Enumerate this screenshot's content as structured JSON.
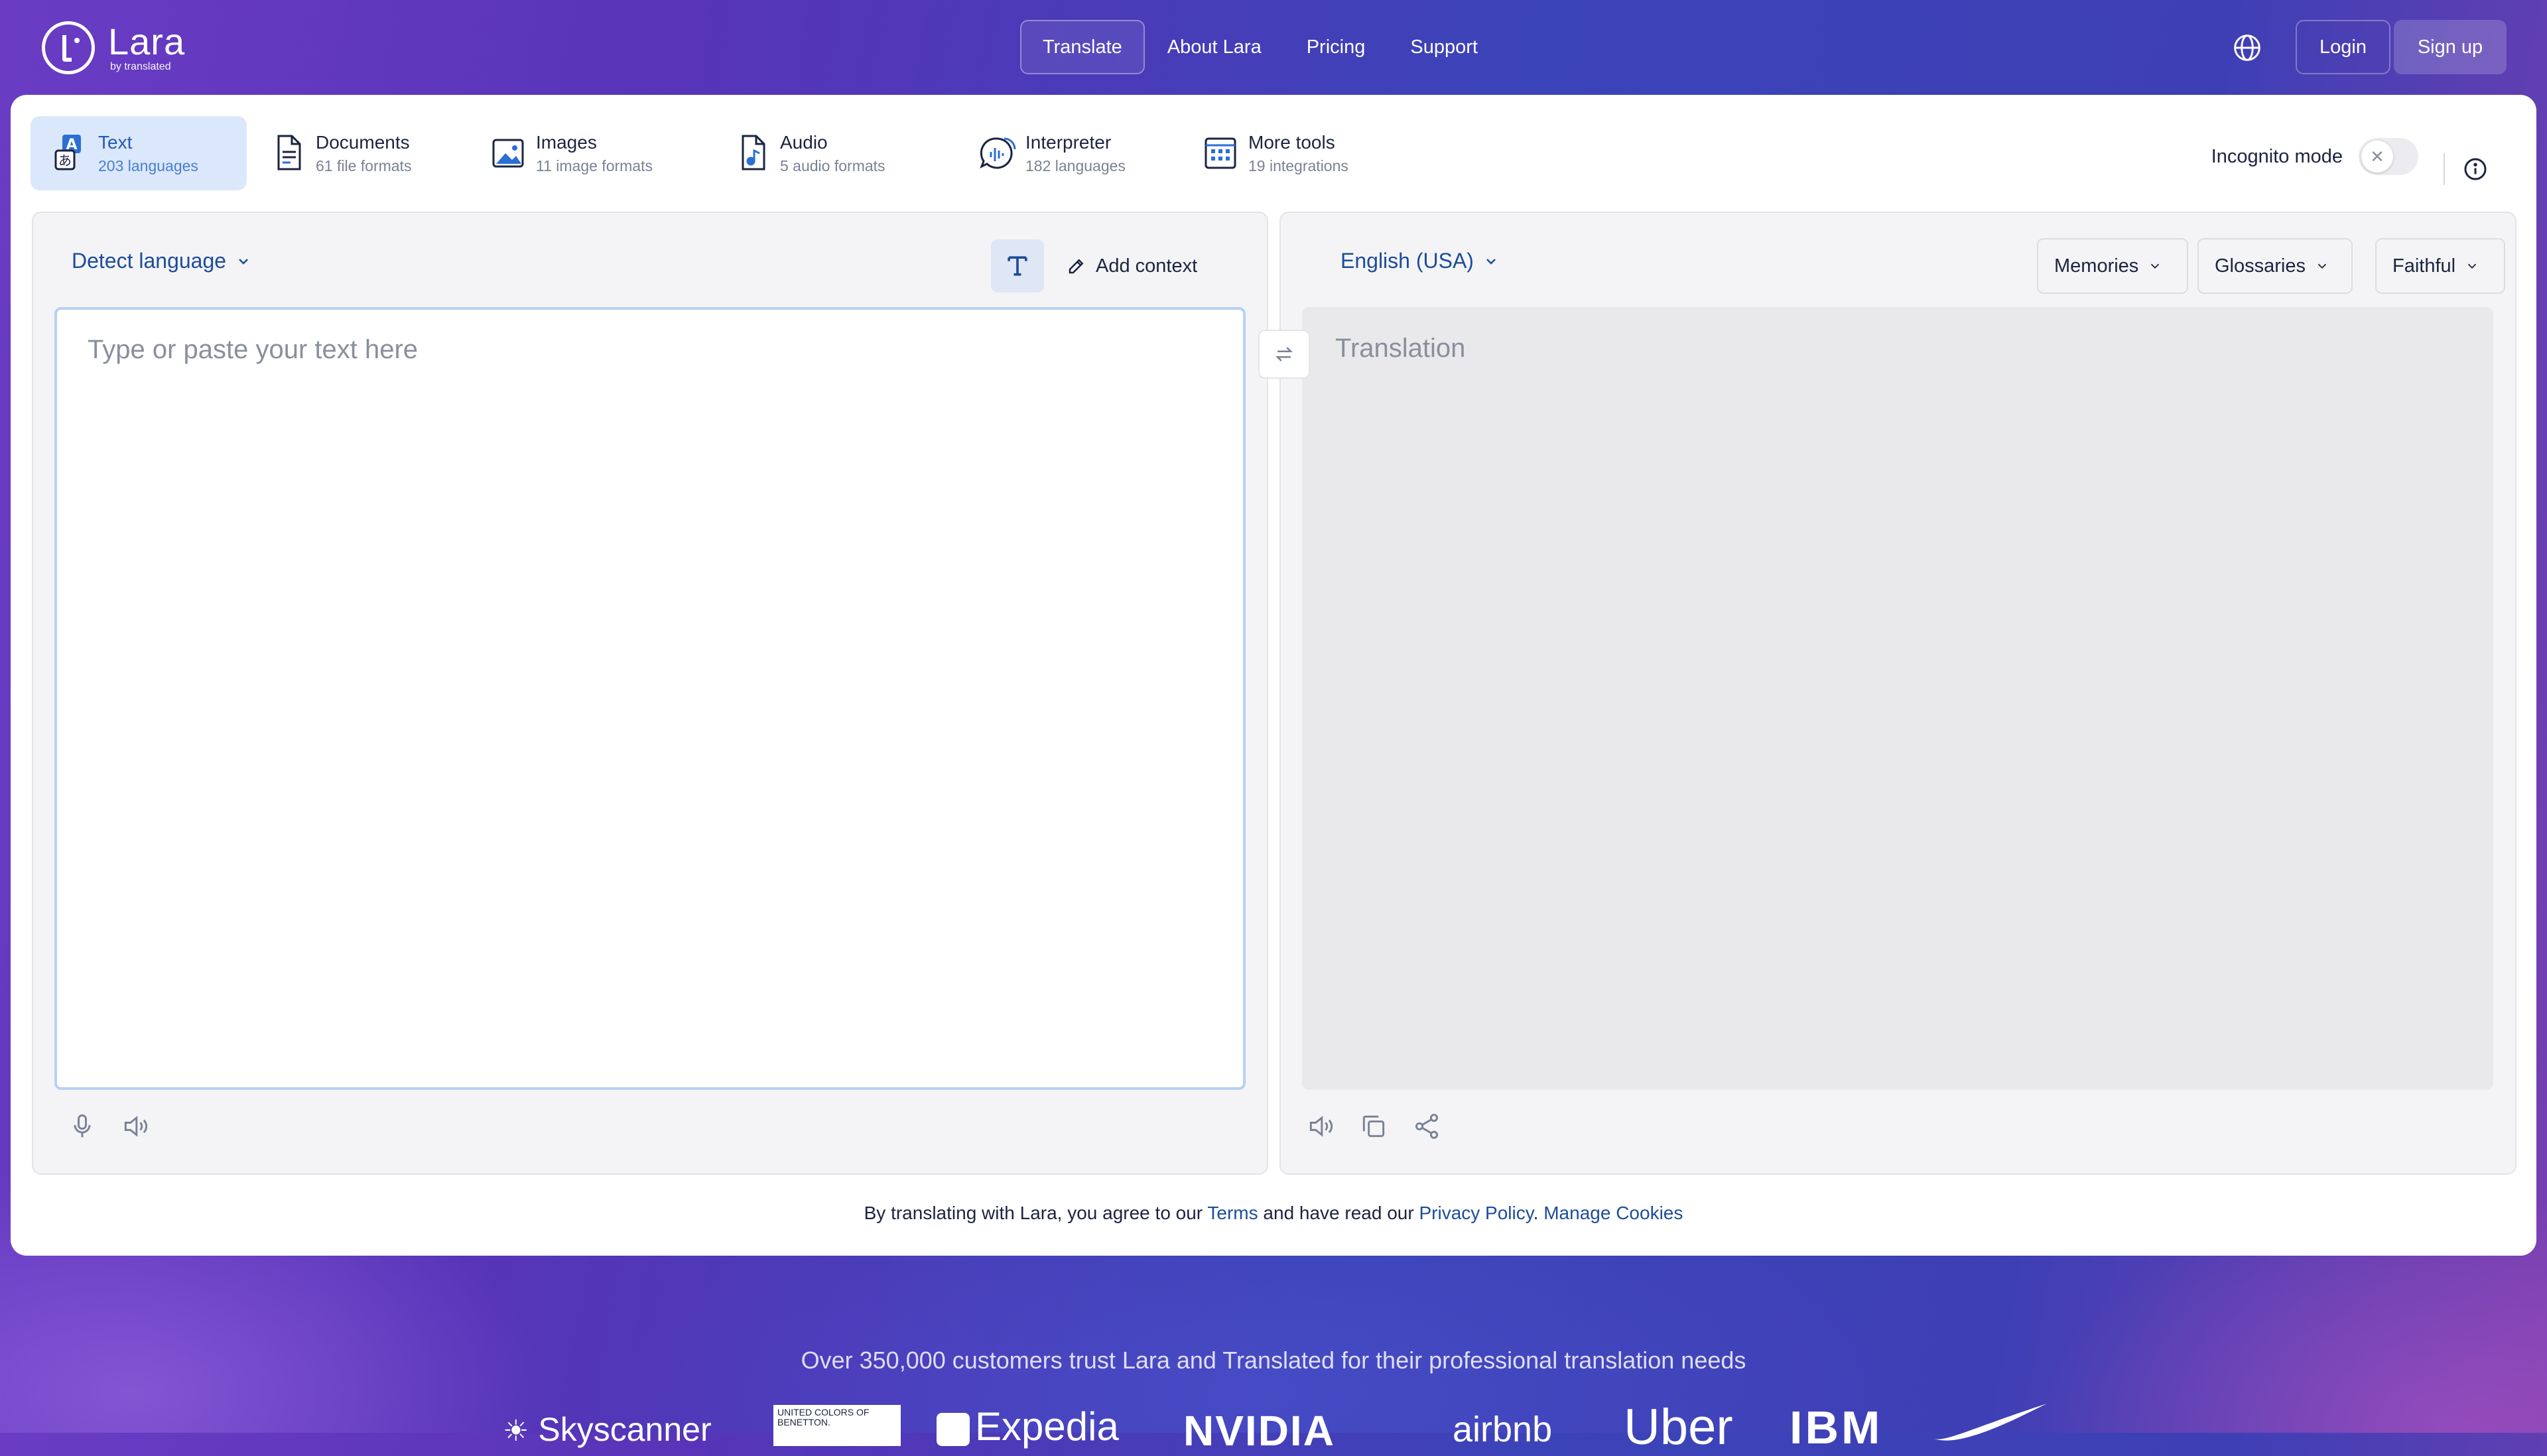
{
  "brand": {
    "name": "Lara",
    "byline": "by translated"
  },
  "nav": {
    "links": [
      {
        "label": "Translate"
      },
      {
        "label": "About Lara"
      },
      {
        "label": "Pricing"
      },
      {
        "label": "Support"
      }
    ],
    "login": "Login",
    "signup": "Sign up"
  },
  "tools": [
    {
      "title": "Text",
      "sub": "203 languages",
      "icon": "text-translate-icon"
    },
    {
      "title": "Documents",
      "sub": "61 file formats",
      "icon": "document-icon"
    },
    {
      "title": "Images",
      "sub": "11 image formats",
      "icon": "image-icon"
    },
    {
      "title": "Audio",
      "sub": "5 audio formats",
      "icon": "audio-file-icon"
    },
    {
      "title": "Interpreter",
      "sub": "182 languages",
      "icon": "interpreter-icon"
    },
    {
      "title": "More tools",
      "sub": "19 integrations",
      "icon": "grid-tools-icon"
    }
  ],
  "incognito": {
    "label": "Incognito mode",
    "enabled": false
  },
  "source": {
    "language": "Detect language",
    "add_context": "Add context",
    "placeholder": "Type or paste your text here",
    "value": ""
  },
  "target": {
    "language": "English (USA)",
    "placeholder": "Translation",
    "options": [
      "Memories",
      "Glossaries",
      "Faithful"
    ]
  },
  "legal": {
    "prefix": "By translating with Lara, you agree to our ",
    "terms": "Terms",
    "middle": " and have read our ",
    "privacy": "Privacy Policy",
    "sep": ". ",
    "cookies": "Manage Cookies"
  },
  "trust": {
    "headline": "Over 350,000 customers trust Lara and Translated for their professional translation needs",
    "brands": [
      "Skyscanner",
      "UNITED COLORS OF BENETTON.",
      "Expedia",
      "NVIDIA",
      "airbnb",
      "Uber",
      "IBM",
      "Nike"
    ]
  },
  "colors": {
    "accent": "#1d4c9a",
    "active_tab_bg": "#dbe8fb",
    "nav_bg": "#4a3cbc"
  }
}
